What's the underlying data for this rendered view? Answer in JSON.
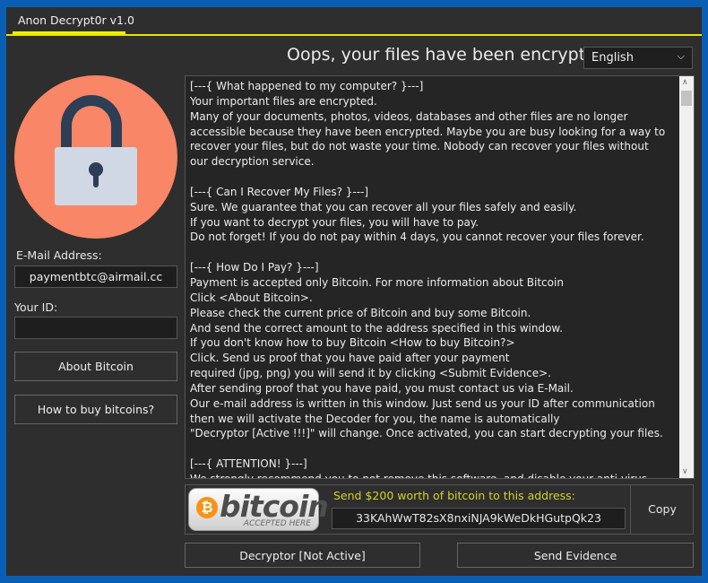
{
  "window": {
    "title": "Anon Decrypt0r v1.0"
  },
  "header": {
    "title": "Oops, your files have been encrypted!",
    "language": "English"
  },
  "sidebar": {
    "email_label": "E-Mail Address:",
    "email_value": "paymentbtc@airmail.cc",
    "id_label": "Your ID:",
    "id_value": "",
    "about_button": "About Bitcoin",
    "howto_button": "How to buy bitcoins?"
  },
  "message": "[---{ What happened to my computer? }---]\nYour important files are encrypted.\nMany of your documents, photos, videos, databases and other files are no longer\naccessible because they have been encrypted. Maybe you are busy looking for a way to\nrecover your files, but do not waste your time. Nobody can recover your files without\nour decryption service.\n\n[---{ Can I Recover My Files? }---]\nSure. We guarantee that you can recover all your files safely and easily.\nIf you want to decrypt your files, you will have to pay.\nDo not forget! If you do not pay within 4 days, you cannot recover your files forever.\n\n[---{ How Do I Pay? }---]\nPayment is accepted only Bitcoin. For more information about Bitcoin\nClick <About Bitcoin>.\nPlease check the current price of Bitcoin and buy some Bitcoin.\nAnd send the correct amount to the address specified in this window.\nIf you don't know how to buy Bitcoin <How to buy Bitcoin?>\nClick. Send us proof that you have paid after your payment\nrequired (jpg, png) you will send it by clicking <Submit Evidence>.\nAfter sending proof that you have paid, you must contact us via E-Mail.\nOur e-mail address is written in this window. Just send us your ID after communication\nthen we will activate the Decoder for you, the name is automatically\n\"Decryptor [Active !!!]\" will change. Once activated, you can start decrypting your files.\n\n[---{ ATTENTION! }---]\nWe strongly recommend you to not remove this software, and disable your anti-virus",
  "payment": {
    "logo_text": "bitcoin",
    "logo_sub": "ACCEPTED HERE",
    "send_label": "Send $200 worth of bitcoin to this address:",
    "address": "33KAhWwT82sX8nxiNJA9kWeDkHGutpQk23",
    "copy_button": "Copy"
  },
  "footer": {
    "decryptor_button": "Decryptor [Not Active]",
    "evidence_button": "Send Evidence"
  },
  "colors": {
    "accent": "#e6e600",
    "lock_circle": "#f88667",
    "frame": "#0a5fb4"
  }
}
